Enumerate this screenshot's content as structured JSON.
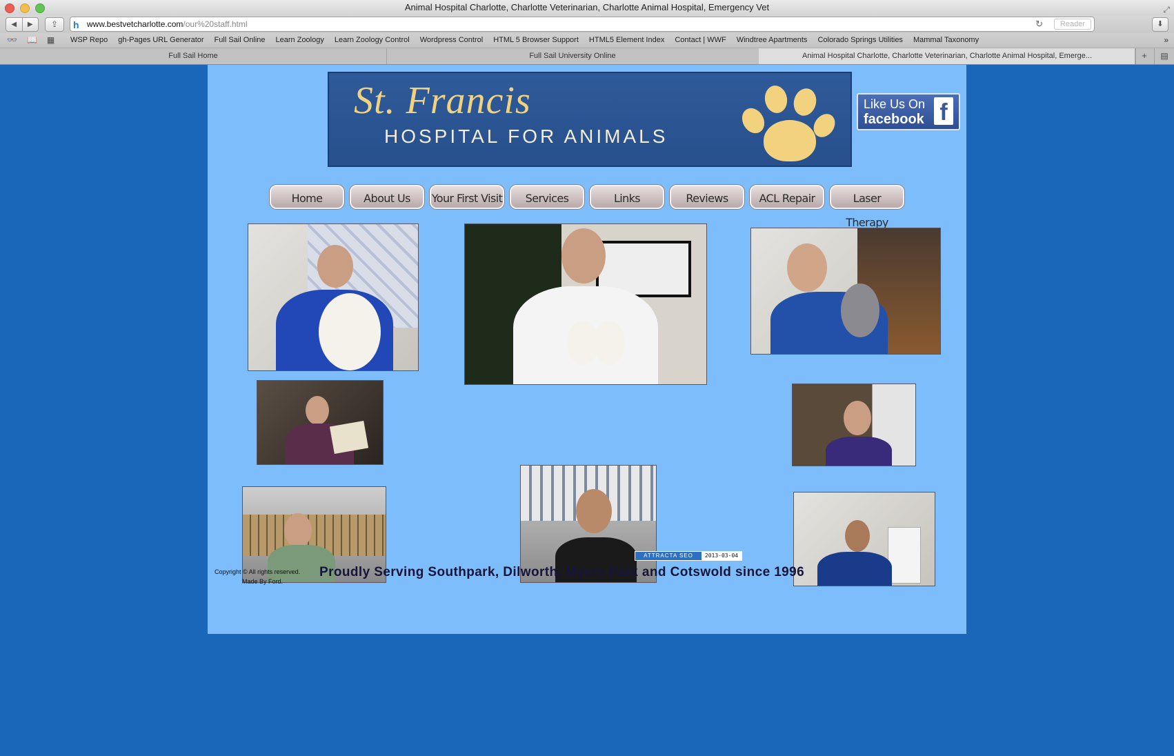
{
  "browser": {
    "window_title": "Animal Hospital Charlotte, Charlotte Veterinarian, Charlotte Animal Hospital, Emergency Vet",
    "url_host": "www.bestvetcharlotte.com",
    "url_path": "/our%20staff.html",
    "reader_label": "Reader",
    "bookmarks": [
      "WSP Repo",
      "gh-Pages URL Generator",
      "Full Sail Online",
      "Learn Zoology",
      "Learn Zoology Control",
      "Wordpress Control",
      "HTML 5 Browser Support",
      "HTML5 Element Index",
      "Contact | WWF",
      "Windtree Apartments",
      "Colorado Springs Utilities",
      "Mammal Taxonomy"
    ],
    "tabs": [
      "Full Sail Home",
      "Full Sail University Online",
      "Animal Hospital Charlotte, Charlotte Veterinarian, Charlotte Animal Hospital, Emerge..."
    ]
  },
  "site": {
    "logo_line1": "St. Francis",
    "logo_line2": "HOSPITAL FOR ANIMALS",
    "facebook_line1": "Like Us On",
    "facebook_line2": "facebook",
    "nav": [
      "Home",
      "About Us",
      "Your First Visit",
      "Services",
      "Links",
      "Reviews",
      "ACL Repair",
      "Laser Therapy"
    ]
  },
  "footer": {
    "copyright_line1": "Copyright © All rights reserved.",
    "copyright_line2": "Made By Ford.",
    "tagline": "Proudly Serving Southpark, Dilworth, Myers Park and Cotswold since 1996",
    "badge_label": "ATTRACTA SEO",
    "badge_date": "2013-03-04"
  },
  "colors": {
    "background": "#1a66b8",
    "page": "#7dbdfb",
    "banner": "#2f5a99",
    "logo_gold": "#f1d27f"
  }
}
